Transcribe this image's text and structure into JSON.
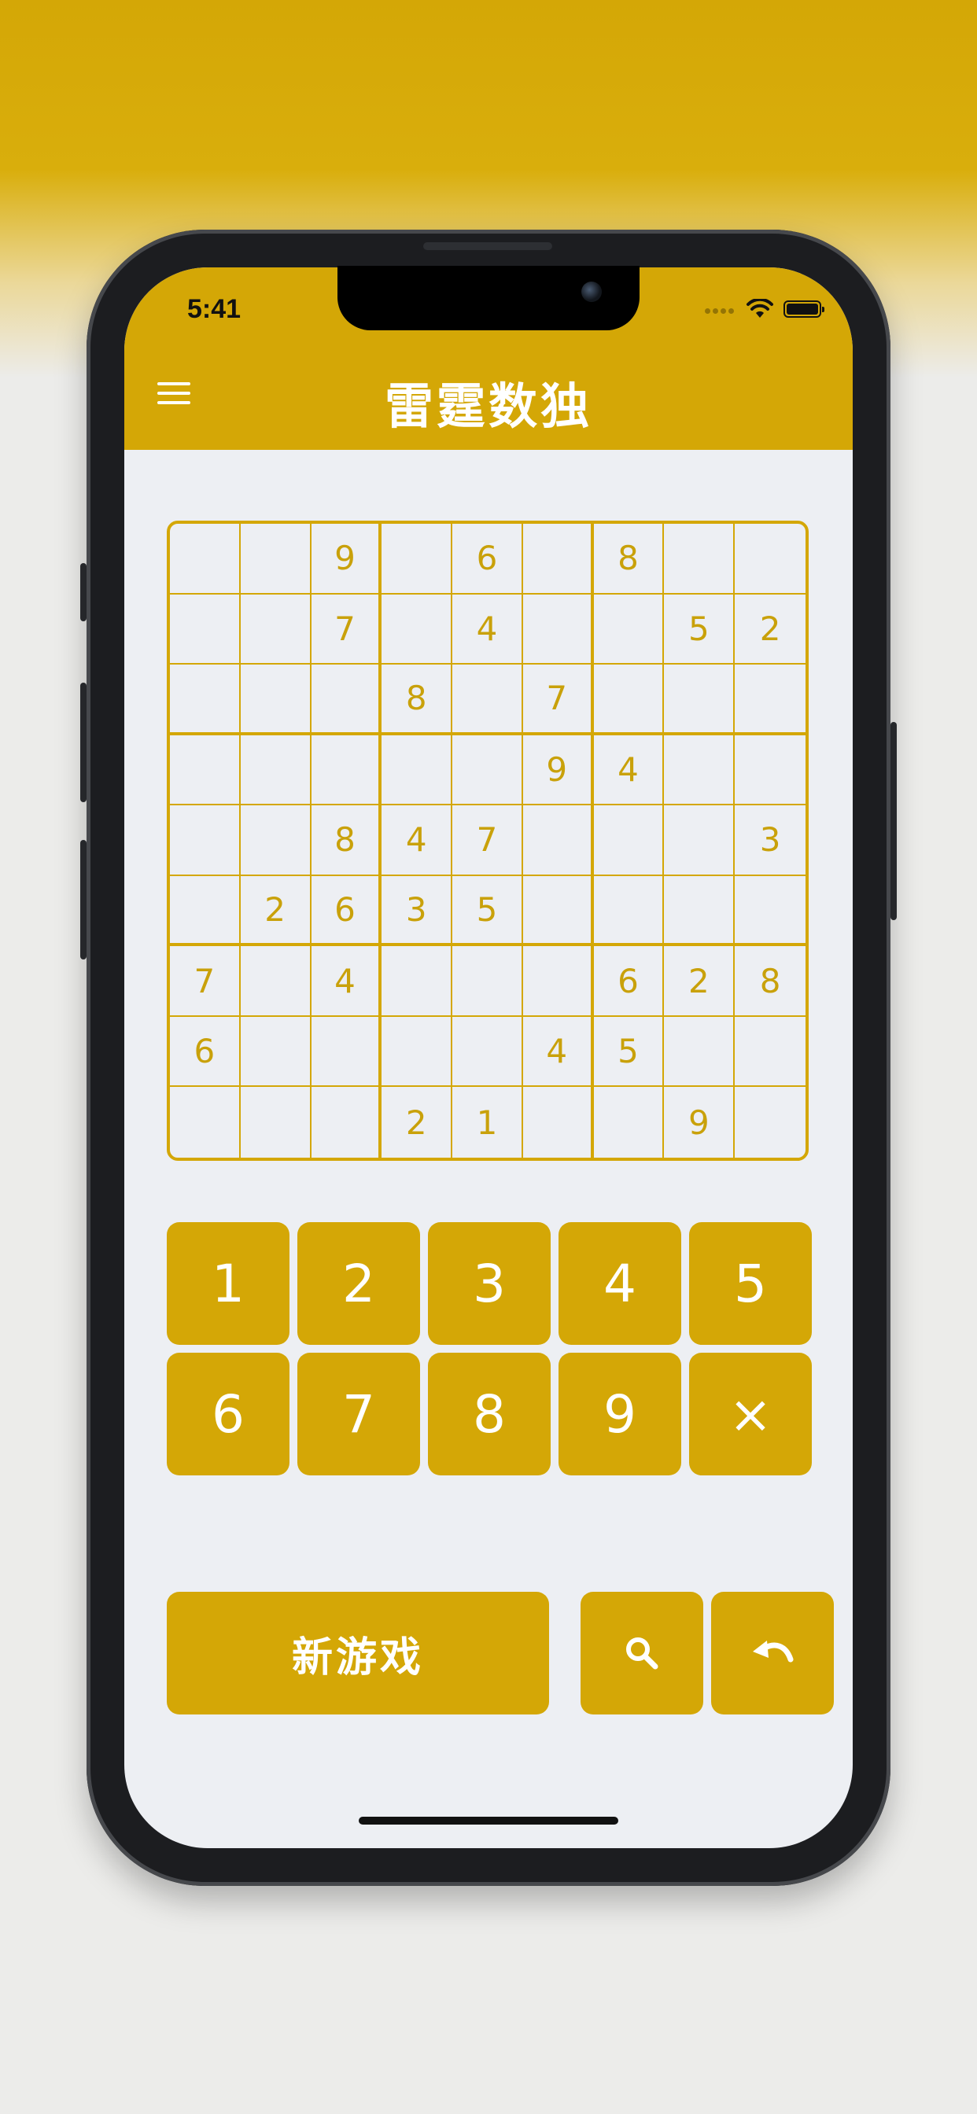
{
  "status_bar": {
    "time": "5:41"
  },
  "app": {
    "title": "雷霆数独"
  },
  "board": [
    [
      "",
      "",
      "9",
      "",
      "6",
      "",
      "8",
      "",
      ""
    ],
    [
      "",
      "",
      "7",
      "",
      "4",
      "",
      "",
      "5",
      "2"
    ],
    [
      "",
      "",
      "",
      "8",
      "",
      "7",
      "",
      "",
      ""
    ],
    [
      "",
      "",
      "",
      "",
      "",
      "9",
      "4",
      "",
      ""
    ],
    [
      "",
      "",
      "8",
      "4",
      "7",
      "",
      "",
      "",
      "3"
    ],
    [
      "",
      "2",
      "6",
      "3",
      "5",
      "",
      "",
      "",
      ""
    ],
    [
      "7",
      "",
      "4",
      "",
      "",
      "",
      "6",
      "2",
      "8"
    ],
    [
      "6",
      "",
      "",
      "",
      "",
      "4",
      "5",
      "",
      ""
    ],
    [
      "",
      "",
      "",
      "2",
      "1",
      "",
      "",
      "9",
      ""
    ]
  ],
  "keypad": {
    "keys": [
      "1",
      "2",
      "3",
      "4",
      "5",
      "6",
      "7",
      "8",
      "9",
      "×"
    ]
  },
  "actions": {
    "new_game": "新游戏",
    "hint_icon": "search-icon",
    "undo_icon": "undo-icon"
  },
  "colors": {
    "accent": "#d4a706",
    "board_digit": "#c9a10a",
    "screen_bg": "#edeff3"
  }
}
